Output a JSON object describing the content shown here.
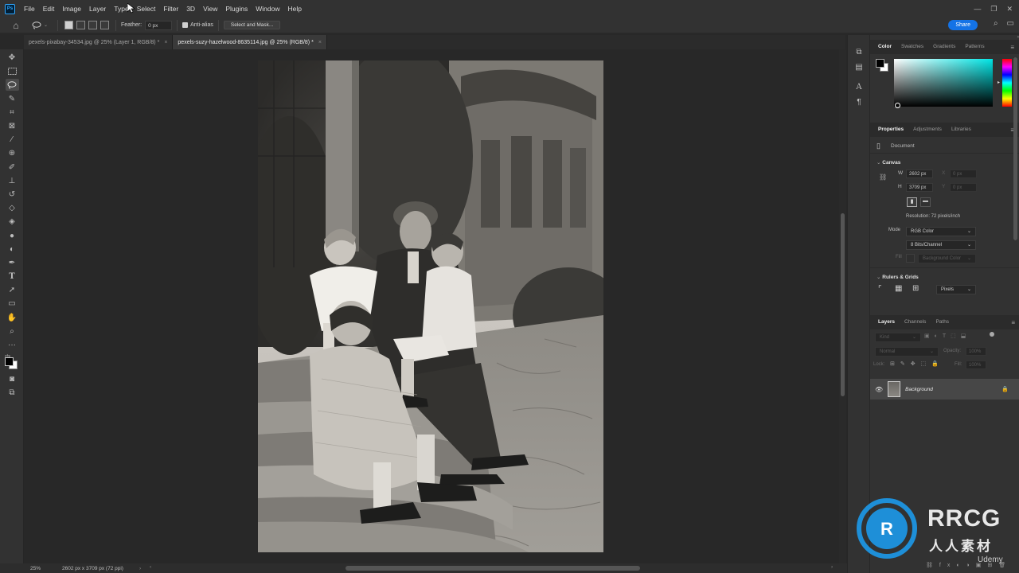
{
  "app": {
    "logo_text": "Ps"
  },
  "menu": [
    "File",
    "Edit",
    "Image",
    "Layer",
    "Type",
    "Select",
    "Filter",
    "3D",
    "View",
    "Plugins",
    "Window",
    "Help"
  ],
  "options_bar": {
    "feather_label": "Feather:",
    "feather_value": "0 px",
    "anti_alias_label": "Anti-alias",
    "select_mask_label": "Select and Mask...",
    "share_label": "Share"
  },
  "tabs": [
    {
      "label": "pexels-pixabay-34534.jpg @ 25% (Layer 1, RGB/8) *",
      "active": false
    },
    {
      "label": "pexels-suzy-hazelwood-8635114.jpg @ 25% (RGB/8) *",
      "active": true
    }
  ],
  "tools": [
    "move-tool",
    "marquee-tool",
    "lasso-tool",
    "quick-select-tool",
    "crop-tool",
    "frame-tool",
    "eyedropper-tool",
    "healing-tool",
    "brush-tool",
    "stamp-tool",
    "history-brush-tool",
    "eraser-tool",
    "gradient-tool",
    "blur-tool",
    "dodge-tool",
    "pen-tool",
    "type-tool",
    "path-select-tool",
    "shape-tool",
    "hand-tool",
    "zoom-tool",
    "more-tools"
  ],
  "active_tool": "lasso-tool",
  "color_panel": {
    "tabs": [
      "Color",
      "Swatches",
      "Gradients",
      "Patterns"
    ],
    "foreground": "#000000",
    "background": "#ffffff",
    "hue_color": "#00e5e5"
  },
  "properties_panel": {
    "tabs": [
      "Properties",
      "Adjustments",
      "Libraries"
    ],
    "document_label": "Document",
    "canvas_header": "Canvas",
    "w_label": "W",
    "w_value": "2602 px",
    "h_label": "H",
    "h_value": "3709 px",
    "x_label": "X",
    "x_value": "0 px",
    "y_label": "Y",
    "y_value": "0 px",
    "resolution": "Resolution: 72 pixels/inch",
    "mode_label": "Mode",
    "mode_value": "RGB Color",
    "bits_value": "8 Bits/Channel",
    "fill_label": "Fill",
    "fill_value": "Background Color",
    "rulers_header": "Rulers & Grids",
    "units_value": "Pixels"
  },
  "layers_panel": {
    "tabs": [
      "Layers",
      "Channels",
      "Paths"
    ],
    "kind_placeholder": "Kind",
    "blend_mode": "Normal",
    "opacity_label": "Opacity:",
    "opacity_value": "100%",
    "lock_label": "Lock:",
    "fill_label": "Fill:",
    "fill_value": "100%",
    "layers": [
      {
        "name": "Background",
        "visible": true,
        "locked": true
      }
    ]
  },
  "status_bar": {
    "zoom": "25%",
    "doc_info": "2602 px x 3709 px (72 ppi)"
  },
  "watermark": {
    "brand": "RRCG",
    "subtitle": "人人素材",
    "udemy": "Udemy"
  }
}
